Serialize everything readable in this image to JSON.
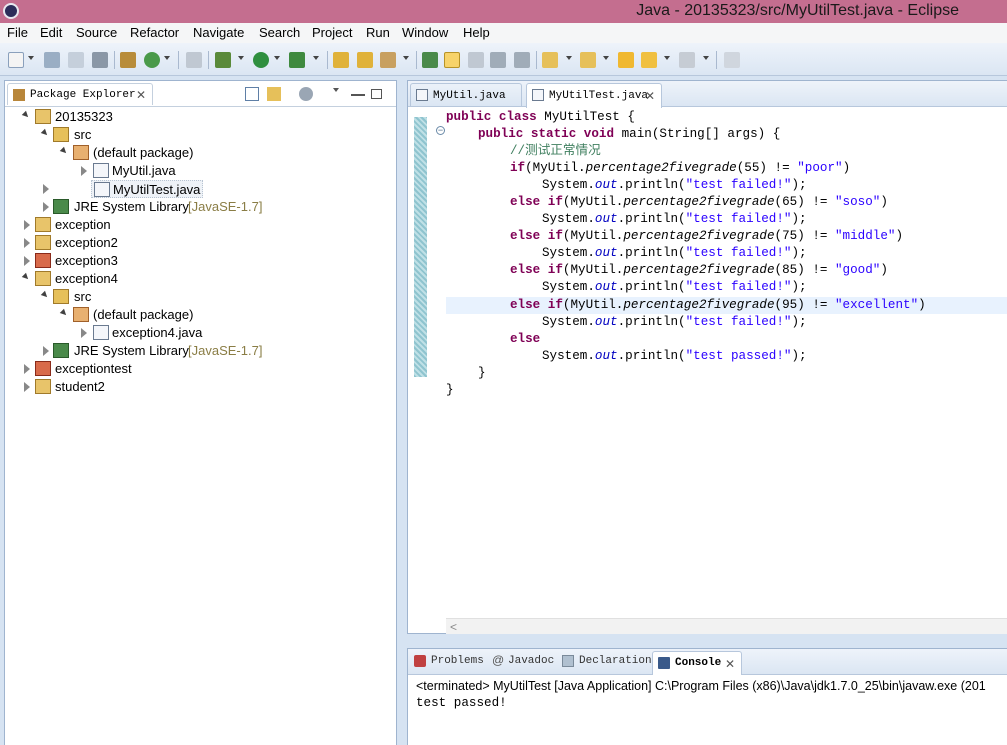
{
  "window": {
    "title": "Java - 20135323/src/MyUtilTest.java - Eclipse"
  },
  "menu": [
    "File",
    "Edit",
    "Source",
    "Refactor",
    "Navigate",
    "Search",
    "Project",
    "Run",
    "Window",
    "Help"
  ],
  "package_explorer": {
    "tab_label": "Package Explorer",
    "tree": {
      "project1": "20135323",
      "src1": "src",
      "default_pkg1": "(default package)",
      "file1": "MyUtil.java",
      "file2": "MyUtilTest.java",
      "jre1": "JRE System Library",
      "jre1_ver": "[JavaSE-1.7]",
      "exception": "exception",
      "exception2": "exception2",
      "exception3": "exception3",
      "exception4": "exception4",
      "src2": "src",
      "default_pkg2": "(default package)",
      "file3": "exception4.java",
      "jre2": "JRE System Library",
      "jre2_ver": "[JavaSE-1.7]",
      "exceptiontest": "exceptiontest",
      "student2": "student2"
    }
  },
  "editor": {
    "tabs": [
      "MyUtil.java",
      "MyUtilTest.java"
    ],
    "code": {
      "l1_kw": "public class",
      "l1_rest": " MyUtilTest {",
      "l2_kw": "public static void",
      "l2_rest": " main(String[] args) {",
      "l3_comment": "//测试正常情况",
      "if_kw": "if",
      "else_kw": "else",
      "else_if_kw": "else if",
      "myutil": "(MyUtil.",
      "method": "percentage2fivegrade",
      "n55": "(55) != ",
      "n65": "(65) != ",
      "n75": "(75) != ",
      "n85": "(85) != ",
      "n95": "(95) != ",
      "s_poor": "\"poor\"",
      "s_soso": "\"soso\"",
      "s_middle": "\"middle\"",
      "s_good": "\"good\"",
      "s_excellent": "\"excellent\"",
      "close_paren": ")",
      "sys": "System.",
      "out": "out",
      "println": ".println(",
      "s_failed": "\"test failed!\"",
      "s_passed": "\"test passed!\"",
      "end_stmt": ");",
      "brace": "}"
    }
  },
  "console": {
    "tabs": [
      "Problems",
      "Javadoc",
      "Declaration",
      "Console"
    ],
    "status": "<terminated> MyUtilTest [Java Application] C:\\Program Files (x86)\\Java\\jdk1.7.0_25\\bin\\javaw.exe (201",
    "output": "test passed!"
  }
}
